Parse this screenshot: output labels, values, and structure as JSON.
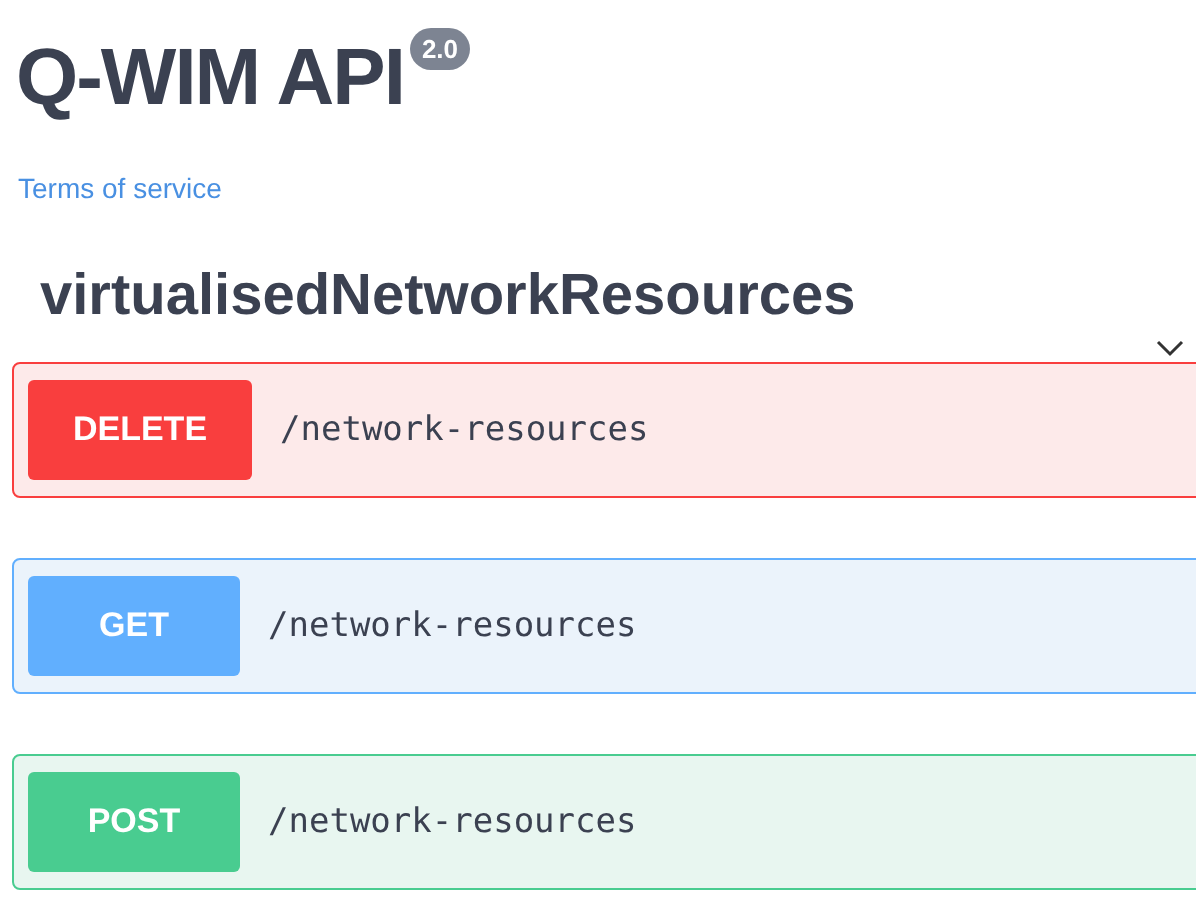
{
  "info": {
    "title": "Q-WIM API",
    "version": "2.0",
    "terms_link": "Terms of service"
  },
  "tag": {
    "name": "virtualisedNetworkResources",
    "expanded": true
  },
  "operations": [
    {
      "method": "DELETE",
      "path": "/network-resources"
    },
    {
      "method": "GET",
      "path": "/network-resources"
    },
    {
      "method": "POST",
      "path": "/network-resources"
    }
  ]
}
